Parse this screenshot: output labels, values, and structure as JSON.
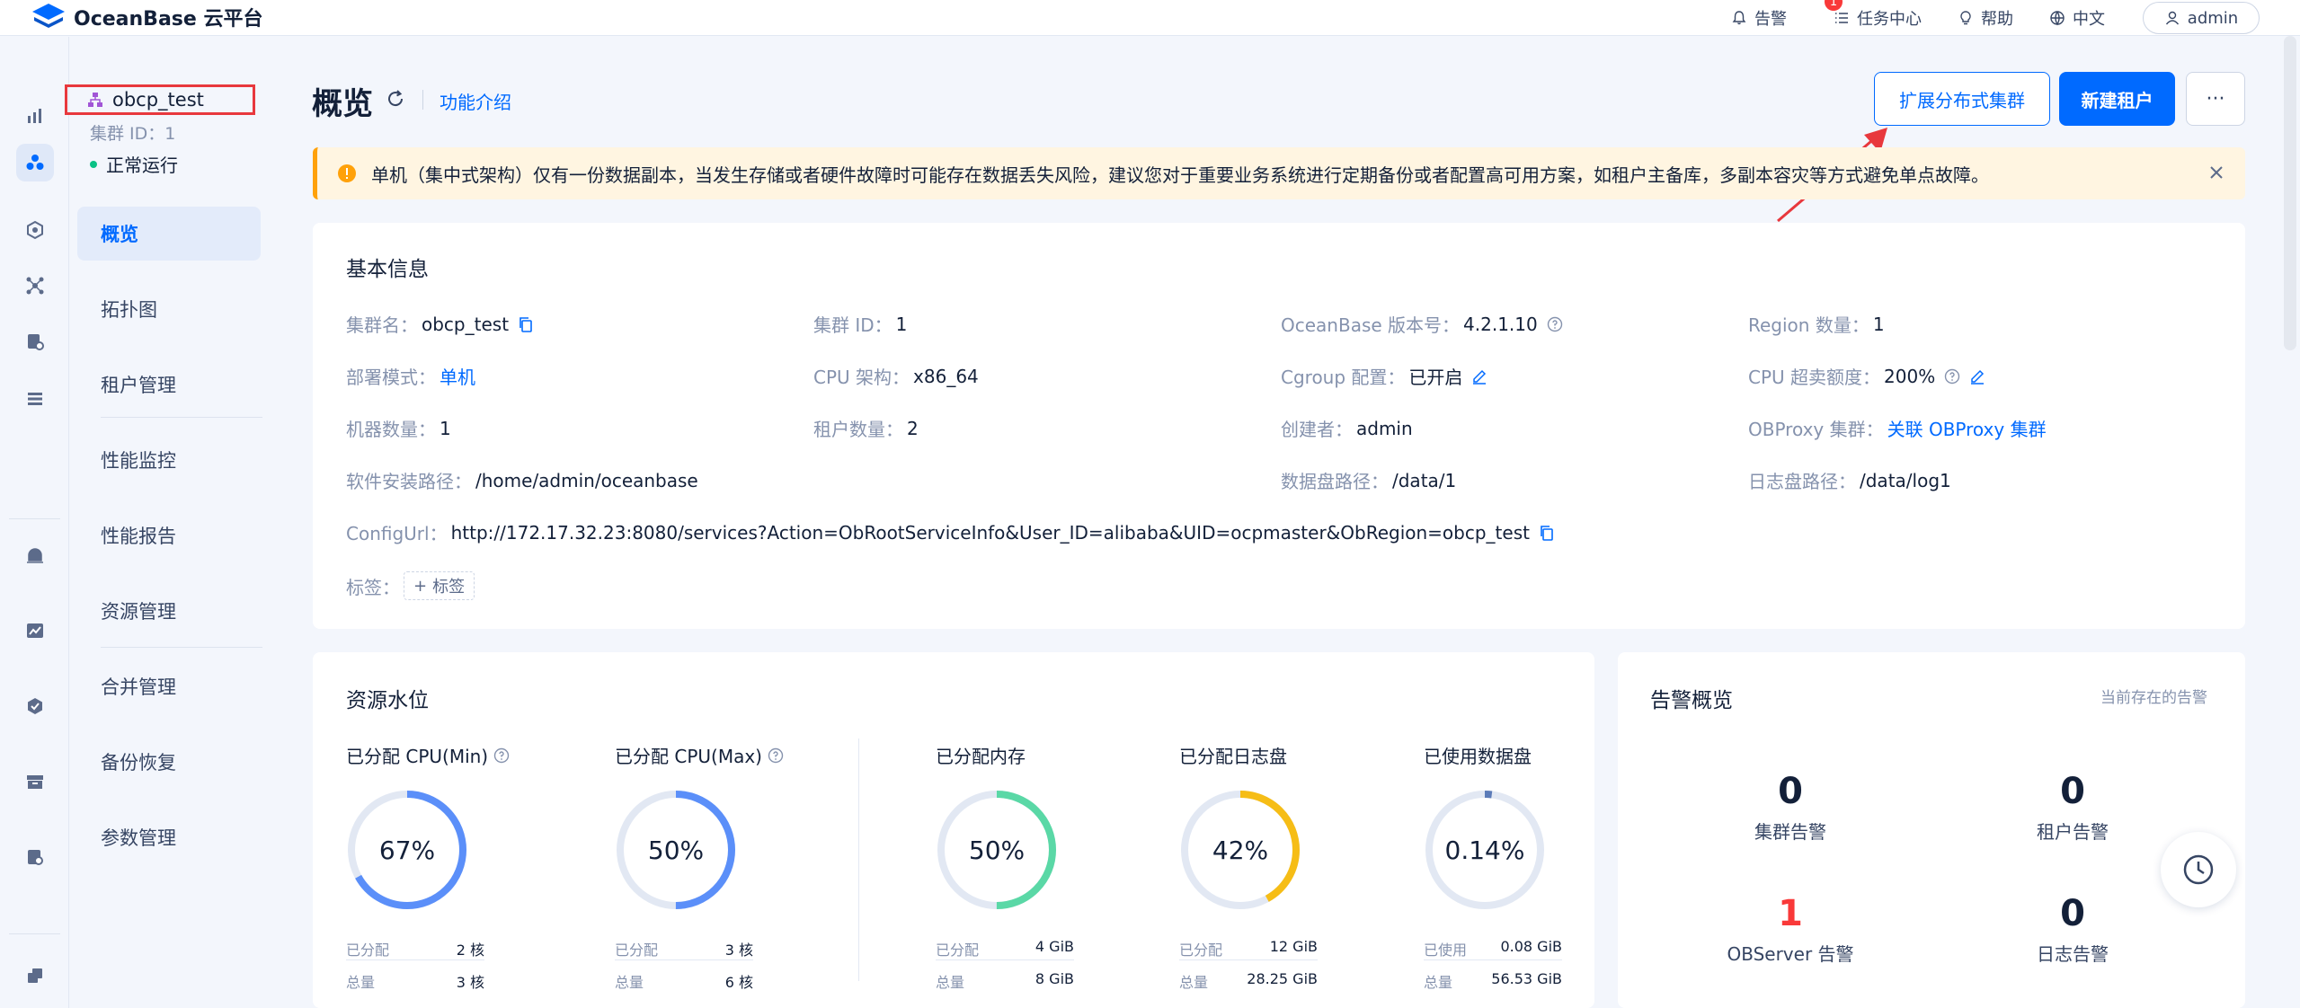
{
  "app": {
    "logo_text": "OceanBase 云平台"
  },
  "topbar": {
    "alarm_label": "告警",
    "alarm_badge": "1",
    "tasks_label": "任务中心",
    "help_label": "帮助",
    "lang_label": "中文",
    "user_label": "admin"
  },
  "cluster": {
    "name": "obcp_test",
    "id_text": "集群 ID：1",
    "status": "正常运行"
  },
  "nav": {
    "items": [
      "概览",
      "拓扑图",
      "租户管理",
      "性能监控",
      "性能报告",
      "资源管理",
      "合并管理",
      "备份恢复",
      "参数管理"
    ]
  },
  "page": {
    "title": "概览",
    "intro_link": "功能介绍",
    "btn_expand": "扩展分布式集群",
    "btn_new_tenant": "新建租户",
    "btn_more": "···"
  },
  "alert": {
    "text": "单机（集中式架构）仅有一份数据副本，当发生存储或者硬件故障时可能存在数据丢失风险，建议您对于重要业务系统进行定期备份或者配置高可用方案，如租户主备库，多副本容灾等方式避免单点故障。"
  },
  "basic": {
    "title": "基本信息",
    "cluster_name_k": "集群名：",
    "cluster_name_v": "obcp_test",
    "cluster_id_k": "集群 ID：",
    "cluster_id_v": "1",
    "version_k": "OceanBase 版本号：",
    "version_v": "4.2.1.10",
    "region_k": "Region 数量：",
    "region_v": "1",
    "deploy_k": "部署模式：",
    "deploy_v": "单机",
    "cpu_arch_k": "CPU 架构：",
    "cpu_arch_v": "x86_64",
    "cgroup_k": "Cgroup 配置：",
    "cgroup_v": "已开启",
    "cpu_over_k": "CPU 超卖额度：",
    "cpu_over_v": "200%",
    "machines_k": "机器数量：",
    "machines_v": "1",
    "tenants_k": "租户数量：",
    "tenants_v": "2",
    "creator_k": "创建者：",
    "creator_v": "admin",
    "obproxy_k": "OBProxy 集群：",
    "obproxy_v": "关联 OBProxy 集群",
    "install_path_k": "软件安装路径：",
    "install_path_v": "/home/admin/oceanbase",
    "data_path_k": "数据盘路径：",
    "data_path_v": "/data/1",
    "log_path_k": "日志盘路径：",
    "log_path_v": "/data/log1",
    "config_url_k": "ConfigUrl：",
    "config_url_v": "http://172.17.32.23:8080/services?Action=ObRootServiceInfo&User_ID=alibaba&UID=ocpmaster&ObRegion=obcp_test",
    "tags_k": "标签：",
    "tags_btn": "标签"
  },
  "resources": {
    "title": "资源水位",
    "items": [
      {
        "title": "已分配 CPU(Min)",
        "percent": 67,
        "percent_text": "67%",
        "color": "#5b8ff9",
        "k1": "已分配",
        "v1": "2 核",
        "k2": "总量",
        "v2": "3 核"
      },
      {
        "title": "已分配 CPU(Max)",
        "percent": 50,
        "percent_text": "50%",
        "color": "#5b8ff9",
        "k1": "已分配",
        "v1": "3 核",
        "k2": "总量",
        "v2": "6 核"
      },
      {
        "title": "已分配内存",
        "percent": 50,
        "percent_text": "50%",
        "color": "#5ad8a6",
        "k1": "已分配",
        "v1": "4 GiB",
        "k2": "总量",
        "v2": "8 GiB"
      },
      {
        "title": "已分配日志盘",
        "percent": 42,
        "percent_text": "42%",
        "color": "#f6bd16",
        "k1": "已分配",
        "v1": "12 GiB",
        "k2": "总量",
        "v2": "28.25 GiB"
      },
      {
        "title": "已使用数据盘",
        "percent": 0.14,
        "percent_text": "0.14%",
        "color": "#5b7bb8",
        "k1": "已使用",
        "v1": "0.08 GiB",
        "k2": "总量",
        "v2": "56.53 GiB"
      }
    ]
  },
  "alarms": {
    "title": "告警概览",
    "hint": "当前存在的告警",
    "cluster_n": "0",
    "cluster_label": "集群告警",
    "tenant_n": "0",
    "tenant_label": "租户告警",
    "observer_n": "1",
    "observer_label": "OBServer 告警",
    "log_n": "0",
    "log_label": "日志告警"
  }
}
